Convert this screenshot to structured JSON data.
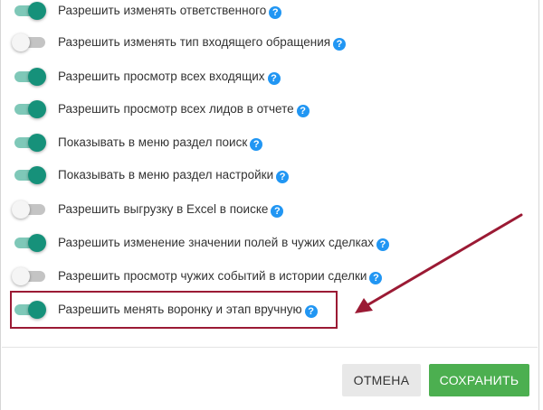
{
  "settings": [
    {
      "label": "Разрешить изменять ответственного",
      "enabled": true
    },
    {
      "label": "Разрешить изменять тип входящего обращения",
      "enabled": false
    },
    {
      "label": "Разрешить просмотр всех входящих",
      "enabled": true
    },
    {
      "label": "Разрешить просмотр всех лидов в отчете",
      "enabled": true
    },
    {
      "label": "Показывать в меню раздел поиск",
      "enabled": true
    },
    {
      "label": "Показывать в меню раздел настройки",
      "enabled": true
    },
    {
      "label": "Разрешить выгрузку в Excel в поиске",
      "enabled": false
    },
    {
      "label": "Разрешить изменение значении полей в чужих сделках",
      "enabled": true
    },
    {
      "label": "Разрешить просмотр чужих событий в истории сделки",
      "enabled": false
    },
    {
      "label": "Разрешить менять воронку и этап вручную",
      "enabled": true
    }
  ],
  "help_glyph": "?",
  "buttons": {
    "cancel_label": "ОТМЕНА",
    "save_label": "СОХРАНИТЬ"
  },
  "colors": {
    "toggle_on": "#16917a",
    "toggle_on_track": "#7fc8b8",
    "toggle_off_track": "#c4c4c4",
    "help_icon": "#2196f3",
    "save_button": "#4caf50",
    "annotation": "#9b1a34"
  }
}
